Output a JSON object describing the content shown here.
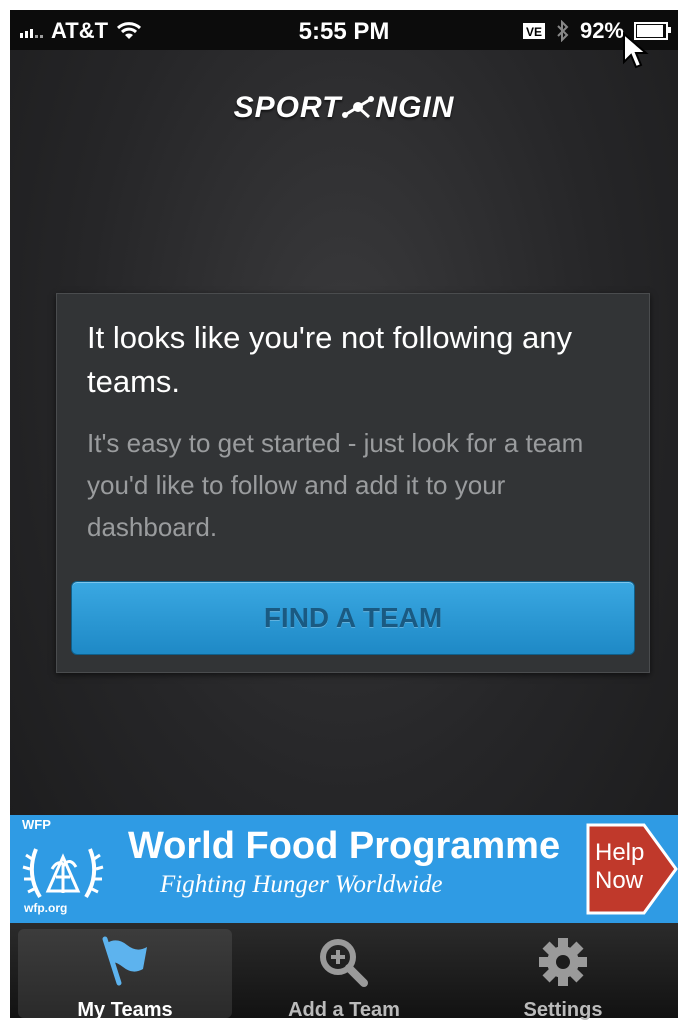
{
  "status_bar": {
    "carrier": "AT&T",
    "time": "5:55 PM",
    "battery_pct": "92%",
    "battery_level": 0.92
  },
  "header": {
    "logo_left": "SPORT",
    "logo_right": "NGIN"
  },
  "empty_state": {
    "title": "It looks like you're not following any teams.",
    "body": "It's easy to get started - just look for a team you'd like to follow and add it to your dashboard.",
    "button_label": "FIND A TEAM"
  },
  "ad_banner": {
    "org_abbr": "WFP",
    "url": "wfp.org",
    "title": "World Food Programme",
    "subtitle": "Fighting Hunger Worldwide",
    "cta": "Help Now"
  },
  "tabbar": {
    "items": [
      {
        "label": "My Teams",
        "icon": "flag-icon",
        "active": true
      },
      {
        "label": "Add a Team",
        "icon": "magnify-plus-icon",
        "active": false
      },
      {
        "label": "Settings",
        "icon": "gear-icon",
        "active": false
      }
    ]
  },
  "colors": {
    "accent_button": "#2a97d4",
    "ad_background": "#2f9be4",
    "help_now": "#c0392b"
  }
}
